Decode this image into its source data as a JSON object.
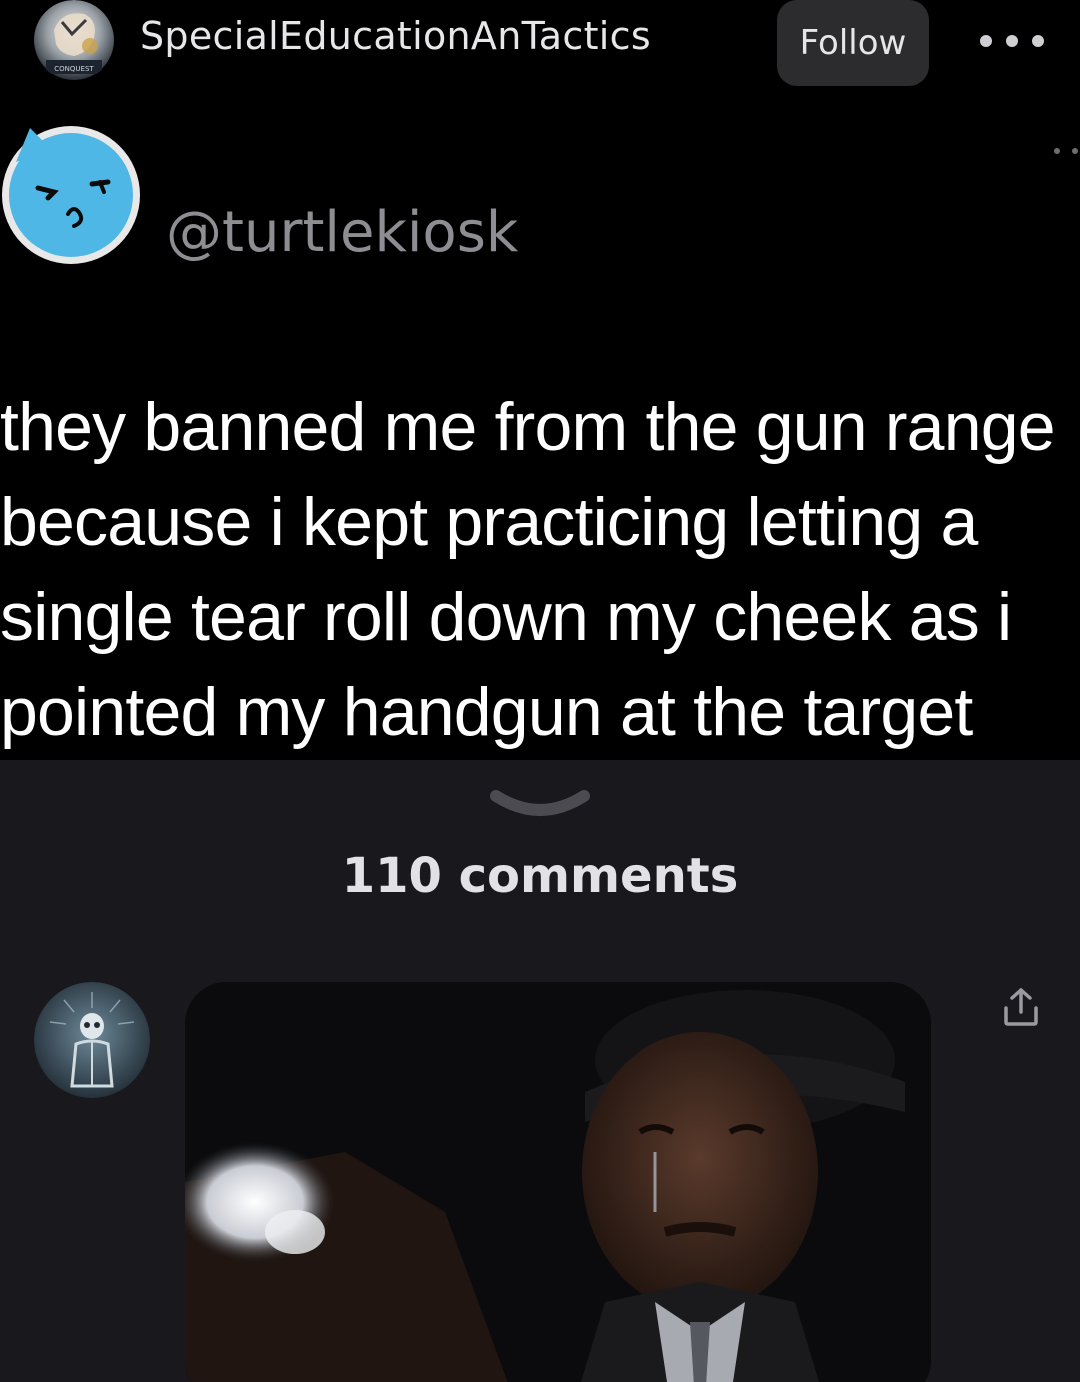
{
  "header": {
    "username": "SpecialEducationAnTactics",
    "follow_label": "Follow",
    "avatar_badge_text": "CONQUEST"
  },
  "tweet": {
    "handle": "@turtlekiosk",
    "lines": [
      "they banned me from the gun range",
      "because i kept practicing letting a",
      "single tear roll down my cheek as i",
      "pointed my handgun at the target"
    ]
  },
  "comments": {
    "count_label": "110 comments"
  },
  "colors": {
    "background": "#000000",
    "sheet": "#19181d",
    "follow_button": "#2c2c2e",
    "tweet_avatar": "#4fb7e6",
    "handle_text": "#8d8d92"
  },
  "icons": {
    "more": "more-horizontal-icon",
    "chevron": "chevron-down-icon",
    "share": "share-upload-icon"
  }
}
